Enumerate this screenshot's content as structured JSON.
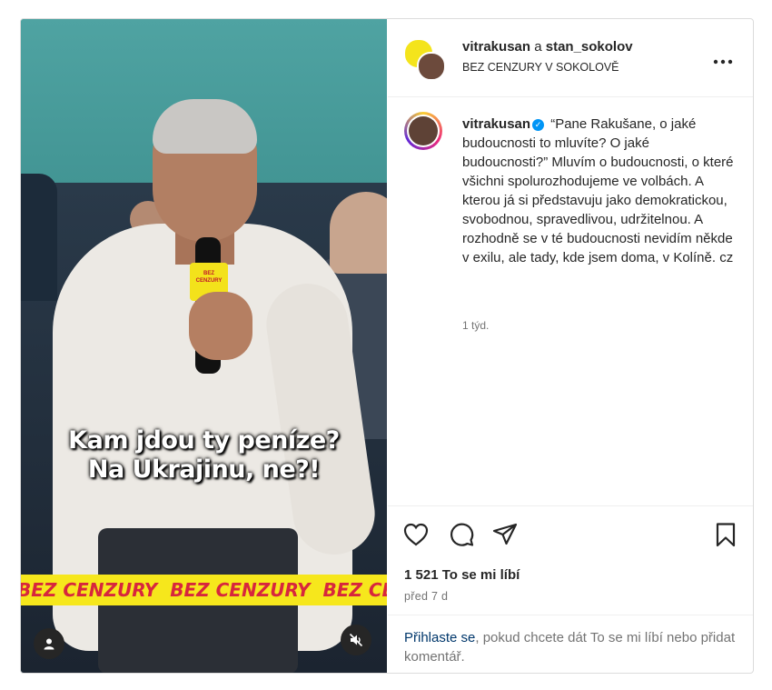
{
  "media": {
    "caption_line1": "Kam jdou ty peníze?",
    "caption_line2": "Na Ukrajinu, ne?!",
    "banner_text": "BEZ CENZURY",
    "mic_text": "BEZ CENZURY",
    "user_icon": "user-icon",
    "mute_icon": "speaker-muted-icon"
  },
  "header": {
    "user1": "vitrakusan",
    "joiner": "a",
    "user2": "stan_sokolov",
    "subtitle": "BEZ CENZURY V SOKOLOVĚ",
    "more_icon": "more-horizontal-icon"
  },
  "comment": {
    "user": "vitrakusan",
    "verified_icon": "verified-badge-icon",
    "text": "“Pane Rakušane, o jaké budoucnosti to mluvíte? O jaké budoucnosti?” Mluvím o budoucnosti, o které všichni spolurozhodujeme ve volbách. A kterou já si představuju jako demokratickou, svobodnou, spravedlivou, udržitelnou. A rozhodně se v té budoucnosti nevidím někde v exilu, ale tady, kde jsem doma, v Kolíně. cz",
    "time": "1 týd."
  },
  "actions": {
    "like_icon": "heart-icon",
    "comment_icon": "comment-icon",
    "share_icon": "share-icon",
    "save_icon": "bookmark-icon",
    "likes": "1 521 To se mi líbí",
    "ago": "před 7 d"
  },
  "footer": {
    "login_link": "Přihlaste se",
    "rest": ", pokud chcete dát To se mi líbí nebo přidat komentář."
  },
  "colors": {
    "banner_bg": "#f6e71c",
    "banner_text": "#d7263d",
    "verified": "#0095f6",
    "link": "#00376b"
  }
}
